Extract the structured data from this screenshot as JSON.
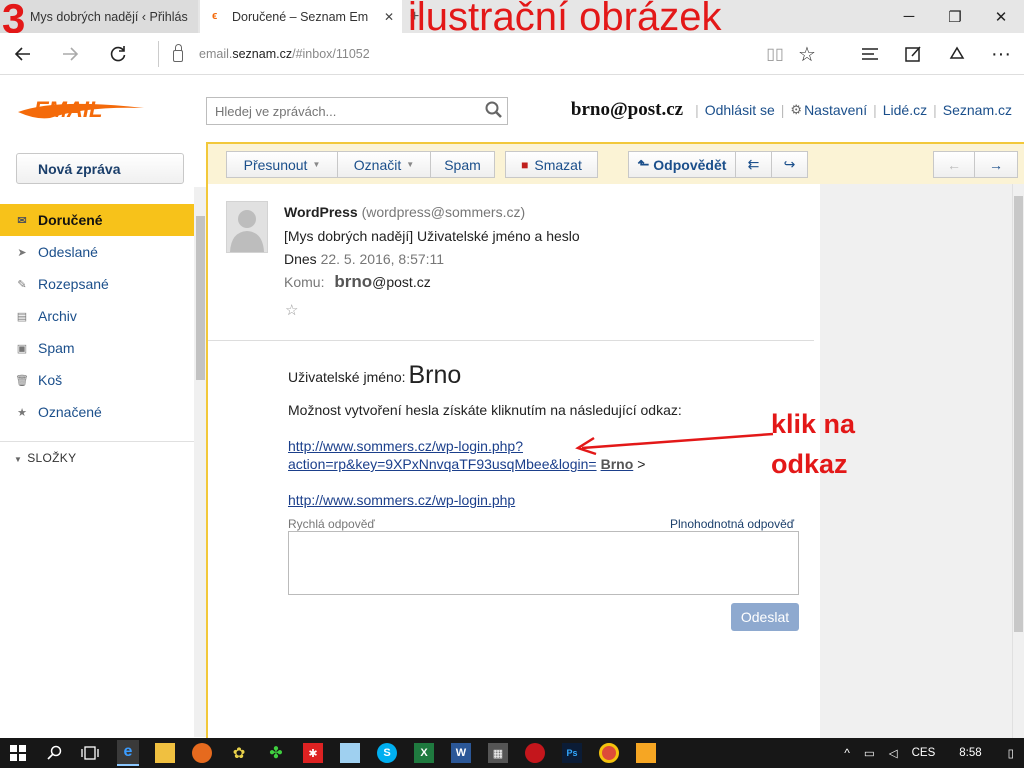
{
  "browser": {
    "tabs": [
      {
        "label": "Mys dobrých nadějí ‹ Přihlás"
      },
      {
        "label": "Doručené – Seznam Em"
      }
    ],
    "address_prefix": "email.",
    "address_domain": "seznam.cz",
    "address_suffix": "/#inbox/11052",
    "new_tab": "+"
  },
  "overlay": {
    "step_number": "3",
    "caption": "ilustrační obrázek",
    "note": "klik na odkaz"
  },
  "header": {
    "search_placeholder": "Hledej ve zprávách...",
    "user_email": "brno@post.cz",
    "logout": "Odhlásit se",
    "settings": "Nastavení",
    "people": "Lidé.cz",
    "seznam": "Seznam.cz"
  },
  "sidebar": {
    "compose": "Nová zpráva",
    "folders": [
      {
        "label": "Doručené",
        "icon": "inbox-icon",
        "glyph": "✉",
        "active": true
      },
      {
        "label": "Odeslané",
        "icon": "sent-icon",
        "glyph": "➤",
        "active": false
      },
      {
        "label": "Rozepsané",
        "icon": "draft-icon",
        "glyph": "✎",
        "active": false
      },
      {
        "label": "Archiv",
        "icon": "archive-icon",
        "glyph": "▤",
        "active": false
      },
      {
        "label": "Spam",
        "icon": "spam-icon",
        "glyph": "▣",
        "active": false
      },
      {
        "label": "Koš",
        "icon": "trash-icon",
        "glyph": "🗑",
        "active": false
      },
      {
        "label": "Označené",
        "icon": "star-icon",
        "glyph": "★",
        "active": false
      }
    ],
    "folders_heading": "SLOŽKY"
  },
  "toolbar": {
    "move": "Přesunout",
    "mark": "Označit",
    "spam": "Spam",
    "delete": "Smazat",
    "reply": "Odpovědět"
  },
  "message": {
    "sender_name": "WordPress",
    "sender_email": "(wordpress@sommers.cz)",
    "subject": "[Mys dobrých nadějí] Uživatelské jméno a heslo",
    "date_prefix": "Dnes",
    "date": "22. 5. 2016, 8:57:11",
    "to_label": "Komu:",
    "to_name": "brno",
    "to_domain": "@post.cz",
    "body": {
      "user_label": "Uživatelské jméno:",
      "user_value": "Brno",
      "info": "Možnost vytvoření hesla získáte kliknutím na následující odkaz:",
      "link_line1": "http://www.sommers.cz/wp-login.php?",
      "link_line2": "action=rp&key=9XPxNnvqaTF93usqMbee&login=",
      "link_login": "Brno",
      "link_close": ">",
      "link_open": "<",
      "login_link": "http://www.sommers.cz/wp-login.php"
    }
  },
  "quick_reply": {
    "label": "Rychlá odpověď",
    "full_reply": "Plnohodnotná odpověď",
    "send": "Odeslat"
  },
  "taskbar": {
    "lang": "CES",
    "time": "8:58"
  },
  "colors": {
    "accent_yellow": "#f7c21a",
    "link_blue": "#1b4f8b",
    "annotation_red": "#e31818",
    "logo_orange": "#f46a0a"
  }
}
